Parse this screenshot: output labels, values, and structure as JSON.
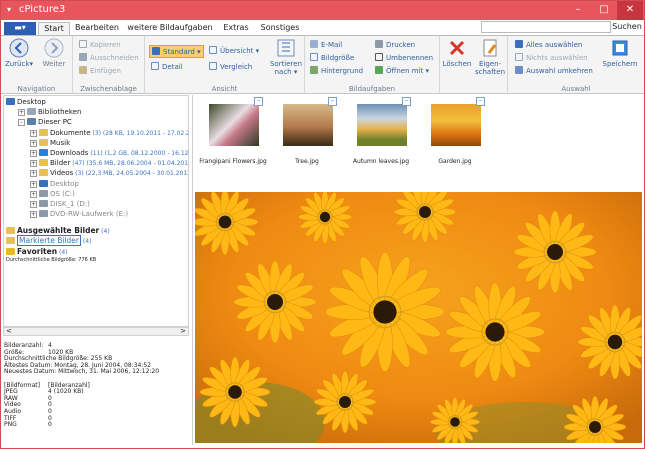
{
  "window": {
    "title": "cPicture3",
    "sysmenu_glyph": "▾",
    "min": "–",
    "max": "□",
    "close": "✕"
  },
  "tabs": {
    "app": "",
    "items": [
      "Start",
      "Bearbeiten",
      "weitere Bildaufgaben",
      "Extras",
      "Sonstiges"
    ],
    "active": 0
  },
  "search": {
    "value": "",
    "button": "Suchen"
  },
  "ribbon": {
    "navigation": {
      "label": "Navigation",
      "back": "Zurück",
      "forward": "Weiter"
    },
    "clipboard": {
      "label": "Zwischenablage",
      "copy": "Kopieren",
      "cut": "Ausschneiden",
      "paste": "Einfügen"
    },
    "view": {
      "label": "Ansicht",
      "standard": "Standard",
      "overview": "Übersicht",
      "detail": "Detail",
      "compare": "Vergleich",
      "sort": "Sortieren",
      "sort2": "nach"
    },
    "imagetasks": {
      "label": "Bildaufgaben",
      "email": "E-Mail",
      "size": "Bildgröße",
      "background": "Hintergrund",
      "print": "Drucken",
      "rename": "Umbenennen",
      "open": "Öffnen mit"
    },
    "delete": "Löschen",
    "properties": "Eigen-",
    "properties2": "schaften",
    "selection": {
      "label": "Auswahl",
      "all": "Alles auswählen",
      "none": "Nichts auswählen",
      "invert": "Auswahl umkehren",
      "save": "Speichern"
    }
  },
  "tree": [
    {
      "label": "Desktop",
      "count": ""
    },
    {
      "label": "Bibliotheken",
      "count": ""
    },
    {
      "label": "Dieser PC",
      "count": ""
    },
    {
      "label": "Dokumente",
      "count": "(3) (28 KB, 19.10.2011 - 17.02.2012)"
    },
    {
      "label": "Musik",
      "count": ""
    },
    {
      "label": "Downloads",
      "count": "(11) (1,2 GB, 08.12.2000 - 16.12.2013)"
    },
    {
      "label": "Bilder",
      "count": "(47) (35,6 MB, 28.06.2004 - 01.04.2014)"
    },
    {
      "label": "Videos",
      "count": "(3) (22,3 MB, 24.05.2004 - 30.01.2012)"
    },
    {
      "label": "Desktop",
      "count": ""
    },
    {
      "label": "OS (C:)",
      "count": ""
    },
    {
      "label": "DISK_1 (D:)",
      "count": ""
    },
    {
      "label": "DVD-RW-Laufwerk (E:)",
      "count": ""
    }
  ],
  "special": {
    "selected": "Ausgewählte Bilder",
    "selected_count": "(4)",
    "marked": "Markierte Bilder",
    "marked_count": "(4)",
    "favorites": "Favoriten",
    "favorites_count": "(4)",
    "avgsize": "Durchschnittliche Bildgröße: 776 KB"
  },
  "info": [
    {
      "k": "Bilderanzahl:",
      "v": "4"
    },
    {
      "k": "Größe:",
      "v": "1020 KB"
    },
    {
      "k": "Durchschnittliche Bildgröße: 255 KB",
      "v": ""
    },
    {
      "k": "Ältestes Datum: Montag, 28. Juni 2004, 08:34:52",
      "v": ""
    },
    {
      "k": "Neuestes Datum: Mittwoch, 31. Mai 2006, 12:12:20",
      "v": ""
    },
    {
      "k": "",
      "v": ""
    },
    {
      "k": "[Bildformat]",
      "v": "[Bilderanzahl]"
    },
    {
      "k": "JPEG",
      "v": "4  (1020 KB)"
    },
    {
      "k": "RAW",
      "v": "0"
    },
    {
      "k": "Video",
      "v": "0"
    },
    {
      "k": "Audio",
      "v": "0"
    },
    {
      "k": "TIFF",
      "v": "0"
    },
    {
      "k": "PNG",
      "v": "0"
    }
  ],
  "thumbs": [
    {
      "name": "Frangipani Flowers.jpg"
    },
    {
      "name": "Tree.jpg"
    },
    {
      "name": "Autumn leaves.jpg"
    },
    {
      "name": "Garden.jpg"
    }
  ],
  "check_glyph": "–"
}
